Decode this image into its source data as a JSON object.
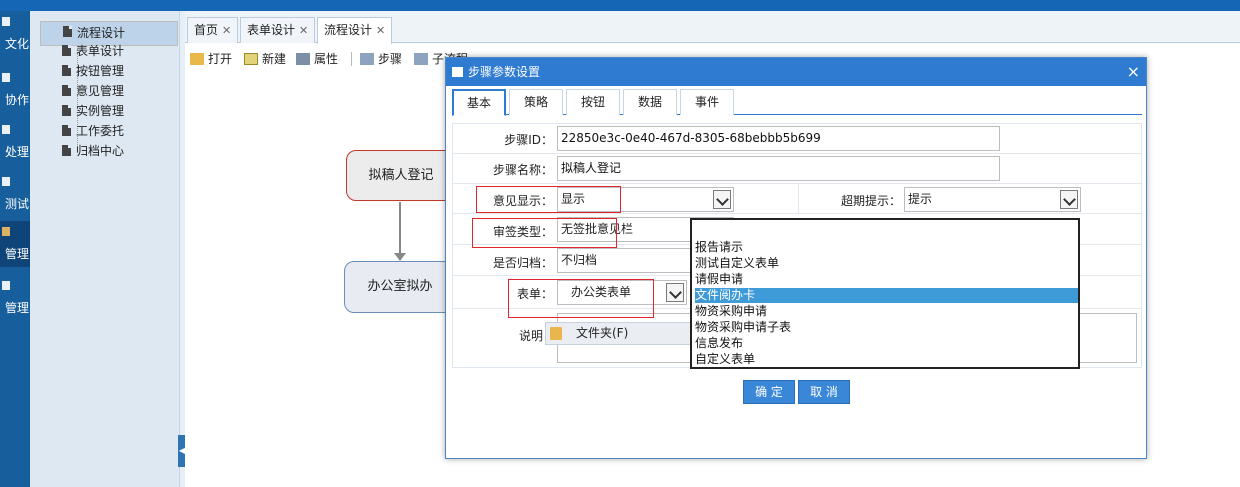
{
  "modules": [
    {
      "label": "文化",
      "icon": "module-icon",
      "active": false
    },
    {
      "label": "协作",
      "icon": "module-icon",
      "active": false
    },
    {
      "label": "处理",
      "icon": "module-icon",
      "active": false
    },
    {
      "label": "测试",
      "icon": "module-icon",
      "active": false
    },
    {
      "label": "管理",
      "icon": "module-icon",
      "active": true
    },
    {
      "label": "管理",
      "icon": "module-icon",
      "active": false
    }
  ],
  "tree": {
    "items": [
      {
        "label": "流程设计",
        "selected": true
      },
      {
        "label": "表单设计",
        "selected": false
      },
      {
        "label": "按钮管理",
        "selected": false
      },
      {
        "label": "意见管理",
        "selected": false
      },
      {
        "label": "实例管理",
        "selected": false
      },
      {
        "label": "工作委托",
        "selected": false
      },
      {
        "label": "归档中心",
        "selected": false
      }
    ]
  },
  "tabs": [
    {
      "label": "首页"
    },
    {
      "label": "表单设计"
    },
    {
      "label": "流程设计"
    }
  ],
  "toolbar": {
    "open": "打开",
    "new": "新建",
    "props": "属性",
    "step": "步骤",
    "substep": "子流程"
  },
  "flow": {
    "node1": "拟稿人登记",
    "node2": "办公室拟办"
  },
  "dialog": {
    "title": "步骤参数设置",
    "close": "×",
    "tabs": [
      "基本",
      "策略",
      "按钮",
      "数据",
      "事件"
    ],
    "fields": {
      "step_id_label": "步骤ID：",
      "step_id_value": "22850e3c-0e40-467d-8305-68bebbb5b699",
      "step_name_label": "步骤名称：",
      "step_name_value": "拟稿人登记",
      "opinion_label": "意见显示：",
      "opinion_value": "显示",
      "timeout_label": "超期提示：",
      "timeout_value": "提示",
      "sign_label": "审签类型：",
      "sign_value": "无签批意见栏",
      "archive_label": "是否归档：",
      "archive_value": "不归档",
      "form_label": "表单：",
      "form_value": "办公类表单",
      "desc_label": "说明"
    },
    "form_options": [
      {
        "label": "报告请示",
        "highlighted": false
      },
      {
        "label": "测试自定义表单",
        "highlighted": false
      },
      {
        "label": "请假申请",
        "highlighted": false
      },
      {
        "label": "文件阅办卡",
        "highlighted": true
      },
      {
        "label": "物资采购申请",
        "highlighted": false
      },
      {
        "label": "物资采购申请子表",
        "highlighted": false
      },
      {
        "label": "信息发布",
        "highlighted": false
      },
      {
        "label": "自定义表单",
        "highlighted": false
      }
    ],
    "context_menu": {
      "label": "文件夹(F)"
    },
    "ok": "确 定",
    "cancel": "取 消"
  },
  "colors": {
    "topbar": "#1567b5",
    "module_bar": "#175e9c",
    "dialog_title": "#2e7bd1",
    "highlight": "#e0262c",
    "list_highlight": "#3f9ad8"
  }
}
